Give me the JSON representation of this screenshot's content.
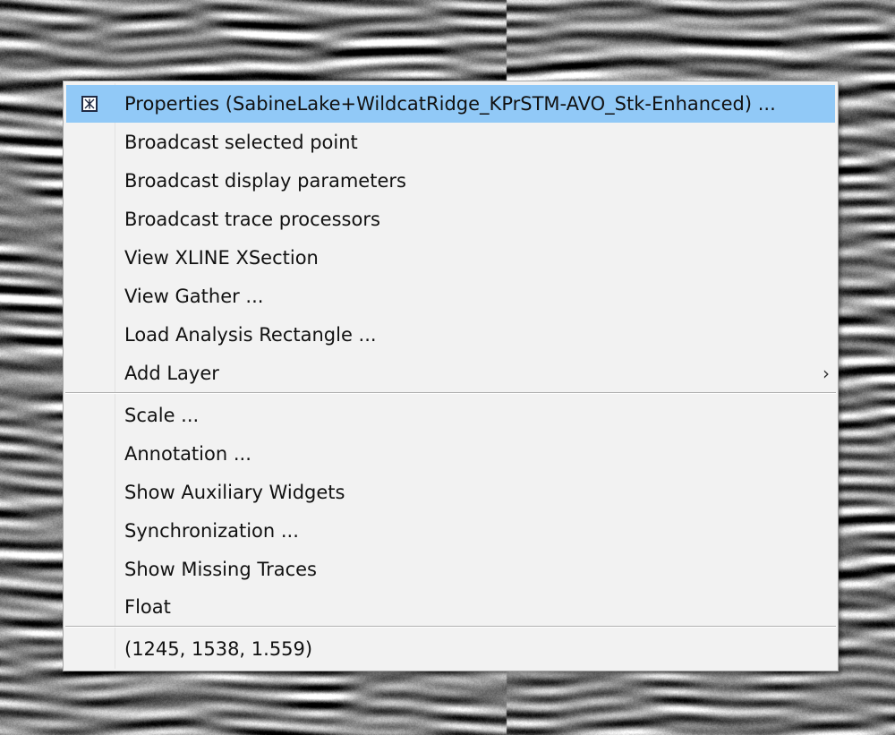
{
  "context_menu": {
    "items": [
      {
        "label": "Properties (SabineLake+WildcatRidge_KPrSTM-AVO_Stk-Enhanced) ...",
        "icon": "properties-icon",
        "highlighted": true
      },
      {
        "label": "Broadcast selected point"
      },
      {
        "label": "Broadcast display parameters"
      },
      {
        "label": "Broadcast trace processors"
      },
      {
        "label": "View XLINE XSection"
      },
      {
        "label": "View Gather ..."
      },
      {
        "label": "Load Analysis Rectangle ..."
      },
      {
        "label": "Add Layer",
        "submenu": true,
        "submenu_arrow": "›"
      },
      {
        "label": "Scale ..."
      },
      {
        "label": "Annotation ..."
      },
      {
        "label": "Show Auxiliary Widgets"
      },
      {
        "label": "Synchronization ..."
      },
      {
        "label": "Show Missing Traces"
      },
      {
        "label": "Float"
      },
      {
        "label": "(1245, 1538, 1.559)"
      }
    ]
  },
  "colors": {
    "menu_background": "#f2f2f2",
    "highlight": "#91c9f7",
    "separator": "#b0b0b0",
    "text": "#111111"
  }
}
